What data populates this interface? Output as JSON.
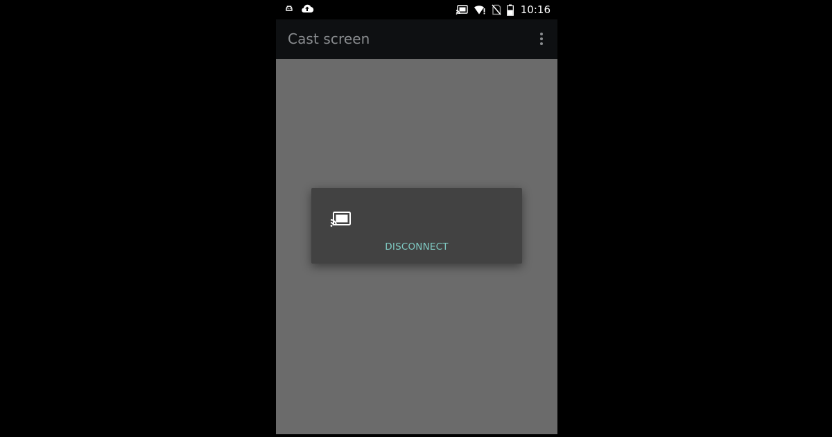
{
  "status_bar": {
    "time": "10:16",
    "icons": [
      "android-debug-icon",
      "cloud-upload-icon",
      "cast-connected-icon",
      "wifi-alert-icon",
      "no-sim-icon",
      "battery-icon"
    ]
  },
  "app_bar": {
    "title": "Cast screen",
    "menu_icon": "overflow-menu-icon"
  },
  "dialog": {
    "icon": "cast-icon",
    "disconnect_label": "DISCONNECT"
  },
  "colors": {
    "background": "#000000",
    "status_bar": "#000000",
    "app_bar": "#0e1012",
    "title_text": "#8a8d90",
    "content_dimmed": "#6b6b6b",
    "dialog_bg": "#424242",
    "accent": "#80cbc4"
  }
}
